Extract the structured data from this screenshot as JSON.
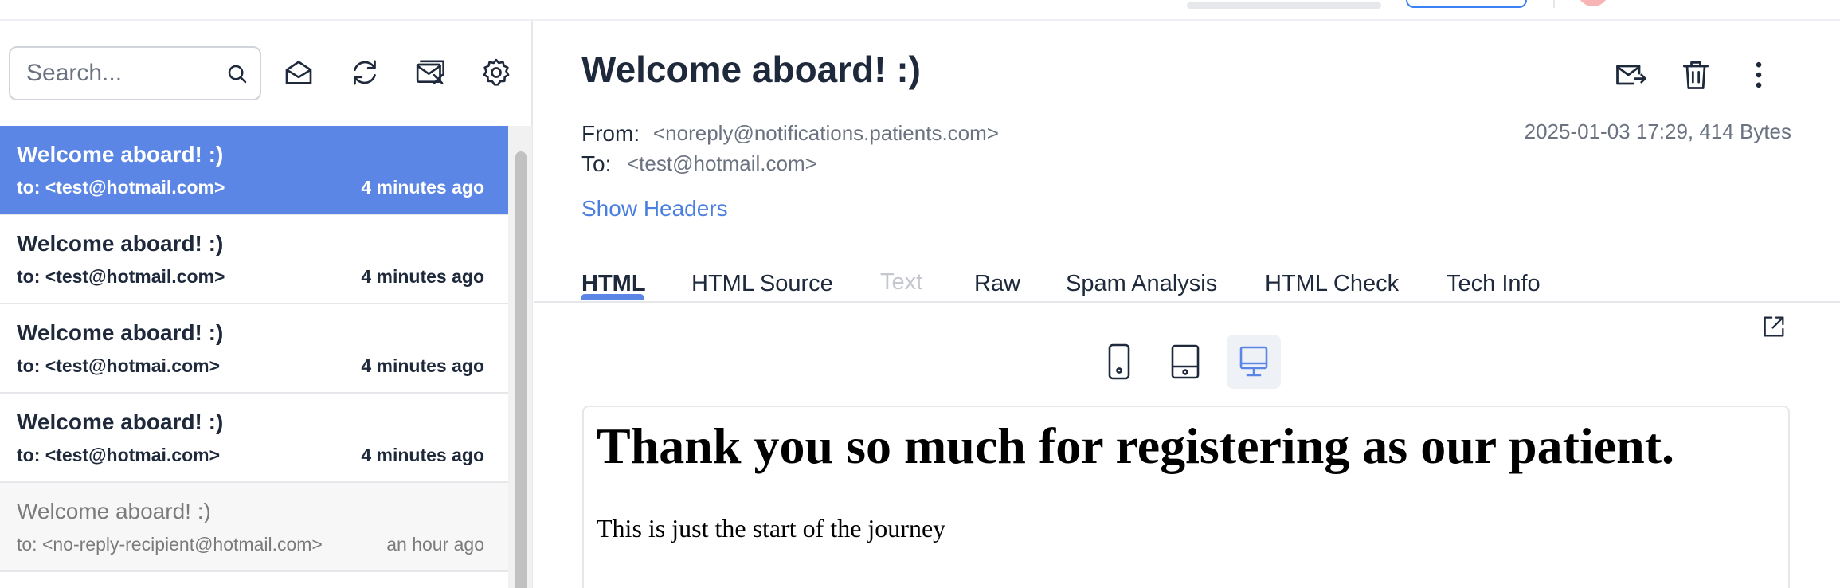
{
  "search": {
    "placeholder": "Search..."
  },
  "toolbar": {
    "icons": [
      "mark-read-icon",
      "refresh-icon",
      "delete-all-icon",
      "settings-icon"
    ]
  },
  "messages": [
    {
      "subject": "Welcome aboard! :)",
      "to": "to: <test@hotmail.com>",
      "time": "4 minutes ago",
      "state": "selected"
    },
    {
      "subject": "Welcome aboard! :)",
      "to": "to: <test@hotmail.com>",
      "time": "4 minutes ago",
      "state": "unread"
    },
    {
      "subject": "Welcome aboard! :)",
      "to": "to: <test@hotmai.com>",
      "time": "4 minutes ago",
      "state": "unread"
    },
    {
      "subject": "Welcome aboard! :)",
      "to": "to: <test@hotmai.com>",
      "time": "4 minutes ago",
      "state": "unread"
    },
    {
      "subject": "Welcome aboard! :)",
      "to": "to: <no-reply-recipient@hotmail.com>",
      "time": "an hour ago",
      "state": "read"
    }
  ],
  "message": {
    "title": "Welcome aboard! :)",
    "from_label": "From:",
    "from_value": "<noreply@notifications.patients.com>",
    "to_label": "To:",
    "to_value": "<test@hotmail.com>",
    "date_size": "2025-01-03 17:29, 414 Bytes",
    "show_headers": "Show Headers"
  },
  "tabs": [
    {
      "label": "HTML",
      "state": "active"
    },
    {
      "label": "HTML Source",
      "state": "normal"
    },
    {
      "label": "Text",
      "state": "disabled"
    },
    {
      "label": "Raw",
      "state": "normal"
    },
    {
      "label": "Spam Analysis",
      "state": "normal"
    },
    {
      "label": "HTML Check",
      "state": "normal"
    },
    {
      "label": "Tech Info",
      "state": "normal"
    }
  ],
  "preview": {
    "heading": "Thank you so much for registering as our patient.",
    "body": "This is just the start of the journey",
    "devices": [
      "phone-icon",
      "tablet-icon",
      "desktop-icon"
    ],
    "active_device": "desktop"
  },
  "colors": {
    "accent": "#5b86e5",
    "link": "#4a7fe0",
    "text": "#1e293b",
    "muted": "#6b7280"
  }
}
